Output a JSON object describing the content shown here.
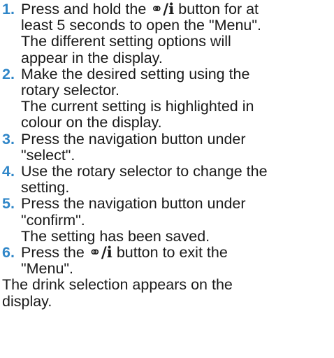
{
  "steps": [
    {
      "number": "1.",
      "lines": [
        {
          "before": "Press and hold the ",
          "icon": "drops-info-button-icon",
          "after": " button for at"
        },
        {
          "text": "least 5 seconds to open the \"Menu\"."
        },
        {
          "text": "The different setting options will"
        },
        {
          "text": "appear in the display."
        }
      ]
    },
    {
      "number": "2.",
      "lines": [
        {
          "text": "Make the desired setting using the"
        },
        {
          "text": "rotary selector."
        },
        {
          "text": "The current setting is highlighted in"
        },
        {
          "text": "colour on the display."
        }
      ]
    },
    {
      "number": "3.",
      "lines": [
        {
          "text": "Press the navigation button under"
        },
        {
          "text": "\"select\"."
        }
      ]
    },
    {
      "number": "4.",
      "lines": [
        {
          "text": "Use the rotary selector to change the"
        },
        {
          "text": "setting."
        }
      ]
    },
    {
      "number": "5.",
      "lines": [
        {
          "text": "Press the navigation button under"
        },
        {
          "text": "\"confirm\"."
        },
        {
          "text": "The setting has been saved."
        }
      ]
    },
    {
      "number": "6.",
      "lines": [
        {
          "before": "Press the ",
          "icon": "drops-info-button-icon",
          "after": " button to exit the"
        },
        {
          "text": "\"Menu\"."
        }
      ]
    }
  ],
  "outro": {
    "lines": [
      "The drink selection appears on the",
      "display."
    ]
  },
  "colors": {
    "step_number": "#2f86c8",
    "text": "#1a1a1a",
    "background": "#ffffff"
  }
}
